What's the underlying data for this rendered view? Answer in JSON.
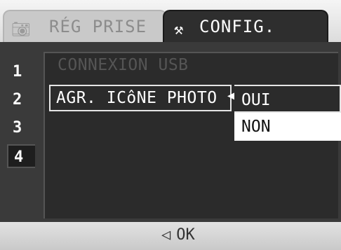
{
  "tabs": [
    {
      "label": "RÉG PRISE",
      "icon": "camera-icon",
      "active": false
    },
    {
      "label": "CONFIG.",
      "icon": "tools-icon",
      "active": true
    }
  ],
  "pages": [
    "1",
    "2",
    "3",
    "4"
  ],
  "active_page": "4",
  "menu": {
    "items": [
      {
        "label": "CONNEXION USB",
        "enabled": false
      },
      {
        "label": "AGR. ICôNE PHOTO",
        "enabled": true,
        "selected": true
      }
    ],
    "options": [
      "OUI",
      "NON"
    ],
    "highlighted_option": "NON"
  },
  "footer": {
    "back_symbol": "◁",
    "ok_label": "OK"
  },
  "colors": {
    "menu_bg": "#3a3a3a",
    "active_tab_bg": "#2e2e2e",
    "highlight_bg": "#ffffff"
  }
}
